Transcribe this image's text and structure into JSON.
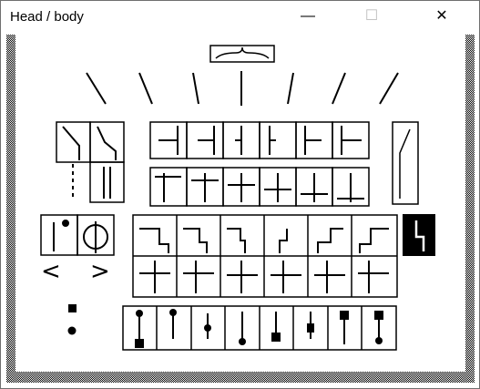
{
  "window": {
    "title": "Head / body",
    "minimize_glyph": "—",
    "maximize_glyph": "☐",
    "close_glyph": "✕"
  },
  "palette": {
    "angle_left": "<",
    "angle_right": ">"
  },
  "colors": {
    "ink": "#000000",
    "background": "#ffffff",
    "frame": "#6f6f6f",
    "disabled": "#bdbdbd"
  }
}
